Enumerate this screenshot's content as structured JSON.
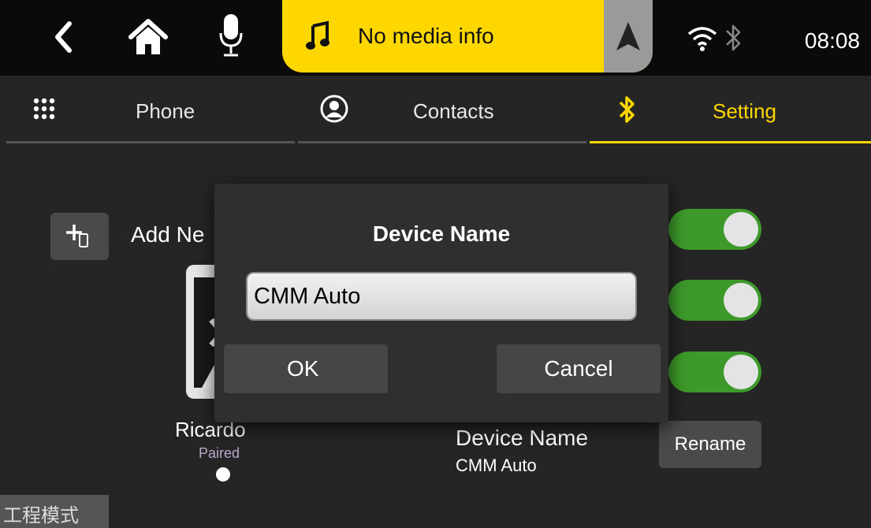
{
  "statusbar": {
    "media_text": "No media info",
    "clock": "08:08",
    "icons": {
      "back": "back-chevron-icon",
      "home": "home-icon",
      "mic": "microphone-icon",
      "music": "music-note-icon",
      "nav": "navigation-arrow-icon",
      "wifi": "wifi-icon",
      "bluetooth": "bluetooth-icon"
    }
  },
  "tabs": [
    {
      "label": "Phone",
      "icon": "keypad-icon",
      "active": false
    },
    {
      "label": "Contacts",
      "icon": "contact-icon",
      "active": false
    },
    {
      "label": "Setting",
      "icon": "bluetooth-icon",
      "active": true
    }
  ],
  "content": {
    "add_new_label": "Add Ne",
    "device": {
      "name": "Ricardo",
      "status": "Paired"
    },
    "device_name_title": "Device Name",
    "device_name_value": "CMM Auto",
    "rename_label": "Rename",
    "engineering_mode": "工程模式"
  },
  "dialog": {
    "title": "Device Name",
    "input_value": "CMM Auto",
    "ok_label": "OK",
    "cancel_label": "Cancel"
  },
  "colors": {
    "accent": "#ffd700",
    "toggle_on": "#3d9a2a",
    "background": "#252525",
    "statusbar": "#0a0a0a"
  }
}
